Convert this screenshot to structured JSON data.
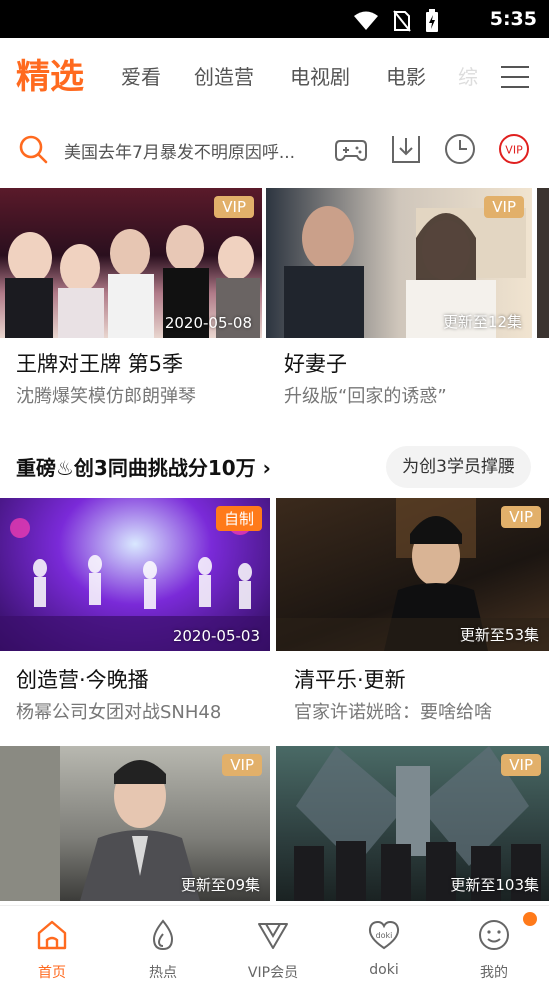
{
  "status_bar": {
    "time": "5:35"
  },
  "top_nav": {
    "tabs": [
      "精选",
      "爱看",
      "创造营",
      "电视剧",
      "电影",
      "综"
    ]
  },
  "search": {
    "placeholder": "美国去年7月暴发不明原因呼..."
  },
  "row1": [
    {
      "badge": "VIP",
      "overlay": "2020-05-08",
      "title": "王牌对王牌 第5季",
      "subtitle": "沈腾爆笑模仿郎朗弹琴"
    },
    {
      "badge": "VIP",
      "overlay": "更新至12集",
      "title": "好妻子",
      "subtitle": "升级版“回家的诱惑”"
    }
  ],
  "section": {
    "title": "重磅♨创3同曲挑战分10万 ›",
    "pill": "为创3学员撑腰"
  },
  "row2": [
    {
      "badge": "自制",
      "overlay": "2020-05-03",
      "title": "创造营·今晚播",
      "subtitle": "杨幂公司女团对战SNH48"
    },
    {
      "badge": "VIP",
      "overlay": "更新至53集",
      "title": "清平乐·更新",
      "subtitle": "官家许诺姯晗：要啥给啥"
    }
  ],
  "row3": [
    {
      "badge": "VIP",
      "overlay": "更新至09集"
    },
    {
      "badge": "VIP",
      "overlay": "更新至103集"
    }
  ],
  "bottom_nav": {
    "items": [
      {
        "label": "首页",
        "icon": "home-icon"
      },
      {
        "label": "热点",
        "icon": "flame-icon"
      },
      {
        "label": "VIP会员",
        "icon": "vip-icon"
      },
      {
        "label": "doki",
        "icon": "doki-heart-icon"
      },
      {
        "label": "我的",
        "icon": "smiley-icon"
      }
    ]
  },
  "colors": {
    "accent": "#ff6a1f",
    "vip_badge": "#e2b06a",
    "own_badge": "#ff7a1a",
    "vip_red": "#e0201f"
  }
}
